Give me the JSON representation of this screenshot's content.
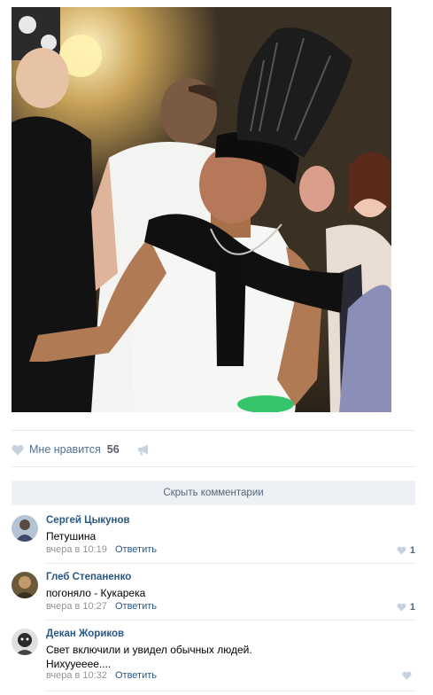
{
  "post": {
    "photo_icon": "photo-party-man"
  },
  "likes": {
    "label": "Мне нравится",
    "count": "56",
    "heart_icon": "heart-icon",
    "share_icon": "megaphone-icon"
  },
  "comments_toggle": {
    "label": "Скрыть комментарии"
  },
  "comments": [
    {
      "author": "Сергей Цыкунов",
      "text_lines": [
        "Петушина"
      ],
      "time": "вчера в 10:19",
      "reply_label": "Ответить",
      "likes": "1"
    },
    {
      "author": "Глеб Степаненко",
      "text_lines": [
        "погоняло - Кукарека"
      ],
      "time": "вчера в 10:27",
      "reply_label": "Ответить",
      "likes": "1"
    },
    {
      "author": "Декан Жориков",
      "text_lines": [
        "Свет включили и увидел обычных людей.",
        "Нихууееее...."
      ],
      "time": "вчера в 10:32",
      "reply_label": "Ответить",
      "likes": ""
    }
  ],
  "colors": {
    "link": "#2a5885",
    "meta": "#939393",
    "toggle_bg": "#edf0f5",
    "divider": "#e7e8ec"
  }
}
